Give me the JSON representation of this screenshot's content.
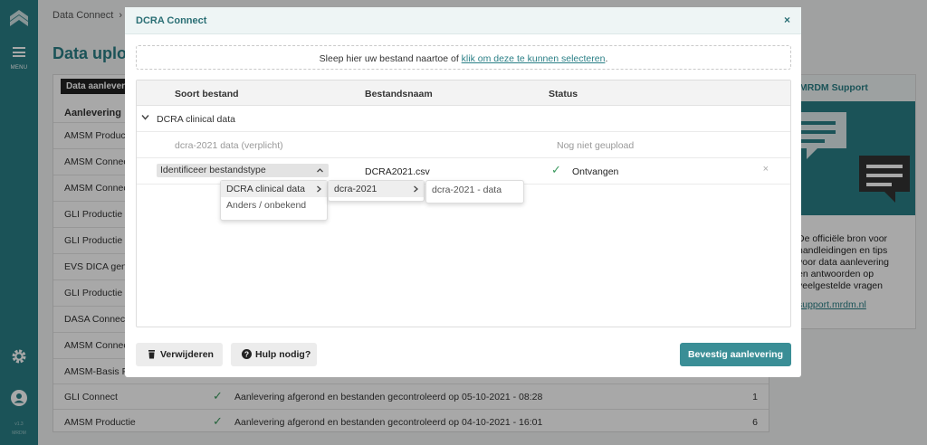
{
  "rail": {
    "menu_label": "MENU",
    "version_1": "v1.3",
    "version_2": "MRDM"
  },
  "page": {
    "breadcrumb": "Data Connect",
    "title": "Data uploa",
    "table_tag": "Data aanleveri",
    "column_header": "Aanlevering",
    "rows": [
      {
        "name": "AMSM Productie",
        "status": "",
        "count": ""
      },
      {
        "name": "AMSM Connect",
        "status": "",
        "count": ""
      },
      {
        "name": "AMSM Connect",
        "status": "",
        "count": ""
      },
      {
        "name": "GLI Productie",
        "status": "",
        "count": ""
      },
      {
        "name": "GLI Productie",
        "status": "",
        "count": ""
      },
      {
        "name": "EVS DICA gene",
        "status": "",
        "count": ""
      },
      {
        "name": "GLI Productie",
        "status": "",
        "count": ""
      },
      {
        "name": "DASA Connect",
        "status": "",
        "count": ""
      },
      {
        "name": "AMSM Connect",
        "status": "",
        "count": ""
      },
      {
        "name": "AMSM-Basis Pr",
        "status": "",
        "count": ""
      },
      {
        "name": "GLI Connect",
        "status": "Aanlevering afgerond en bestanden gecontroleerd op 05-10-2021 - 08:28",
        "count": "1"
      },
      {
        "name": "AMSM Productie",
        "status": "Aanlevering afgerond en bestanden gecontroleerd op 04-10-2021 - 16:01",
        "count": "6"
      }
    ]
  },
  "support": {
    "title": "MRDM Support",
    "text_lines": [
      "De officiële bron voor",
      "handleidingen en tips",
      "voor data aanlevering",
      "en antwoorden op",
      "veelgestelde vragen"
    ],
    "link": "support.mrdm.nl"
  },
  "modal": {
    "title": "DCRA Connect",
    "close_glyph": "×",
    "drop_text": "Sleep hier uw bestand naartoe of ",
    "drop_link": "klik om deze te kunnen selecteren",
    "drop_end": ".",
    "columns": {
      "type": "Soort bestand",
      "name": "Bestandsnaam",
      "status": "Status"
    },
    "group_label": "DCRA clinical data",
    "required_label": "dcra-2021 data (verplicht)",
    "required_status": "Nog niet geupload",
    "file_row": {
      "select_label": "Identificeer bestandstype",
      "file_name": "DCRA2021.csv",
      "status": "Ontvangen",
      "remove_glyph": "×"
    },
    "cascade": {
      "level1": [
        "DCRA clinical data",
        "Anders / onbekend"
      ],
      "level2": [
        "dcra-2021"
      ],
      "level3": [
        "dcra-2021 - data"
      ]
    },
    "buttons": {
      "delete": "Verwijderen",
      "help": "Hulp nodig?",
      "confirm": "Bevestig aanlevering"
    }
  },
  "colors": {
    "accent": "#2a7f86",
    "success": "#3c9a5f",
    "confirm_button": "#3a8e96"
  }
}
